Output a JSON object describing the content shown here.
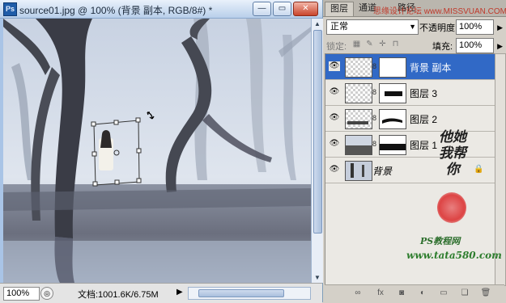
{
  "document": {
    "app_badge": "Ps",
    "title": "source01.jpg @ 100% (背景 副本, RGB/8#) *",
    "window_buttons": [
      "—",
      "▭",
      "✕"
    ],
    "zoom": "100%",
    "doc_info": "文档:1001.6K/6.75M"
  },
  "panel": {
    "tabs": [
      "图层",
      "通道",
      "路径"
    ],
    "blend_mode": "正常",
    "opacity_label": "不透明度:",
    "opacity_value": "100%",
    "lock_label": "锁定:",
    "fill_label": "填充:",
    "fill_value": "100%",
    "layers": [
      {
        "name": "背景 副本",
        "selected": true
      },
      {
        "name": "图层 3",
        "selected": false
      },
      {
        "name": "图层 2",
        "selected": false
      },
      {
        "name": "图层 1",
        "selected": false
      },
      {
        "name": "背景",
        "selected": false,
        "locked": true
      }
    ],
    "footer_icons": [
      "link-icon",
      "fx-icon",
      "mask-icon",
      "adjustment-icon",
      "group-icon",
      "new-layer-icon",
      "trash-icon"
    ]
  },
  "watermark": {
    "top": "思缘设计论坛 www.MISSVUAN.COM",
    "vertical": "他她我帮你",
    "ps_text": "PS教程网",
    "url": "www.tata580.com"
  },
  "colors": {
    "selection": "#3169c6",
    "panel_bg": "#d4d0c8",
    "title_gradient_top": "#e9f1fb"
  }
}
